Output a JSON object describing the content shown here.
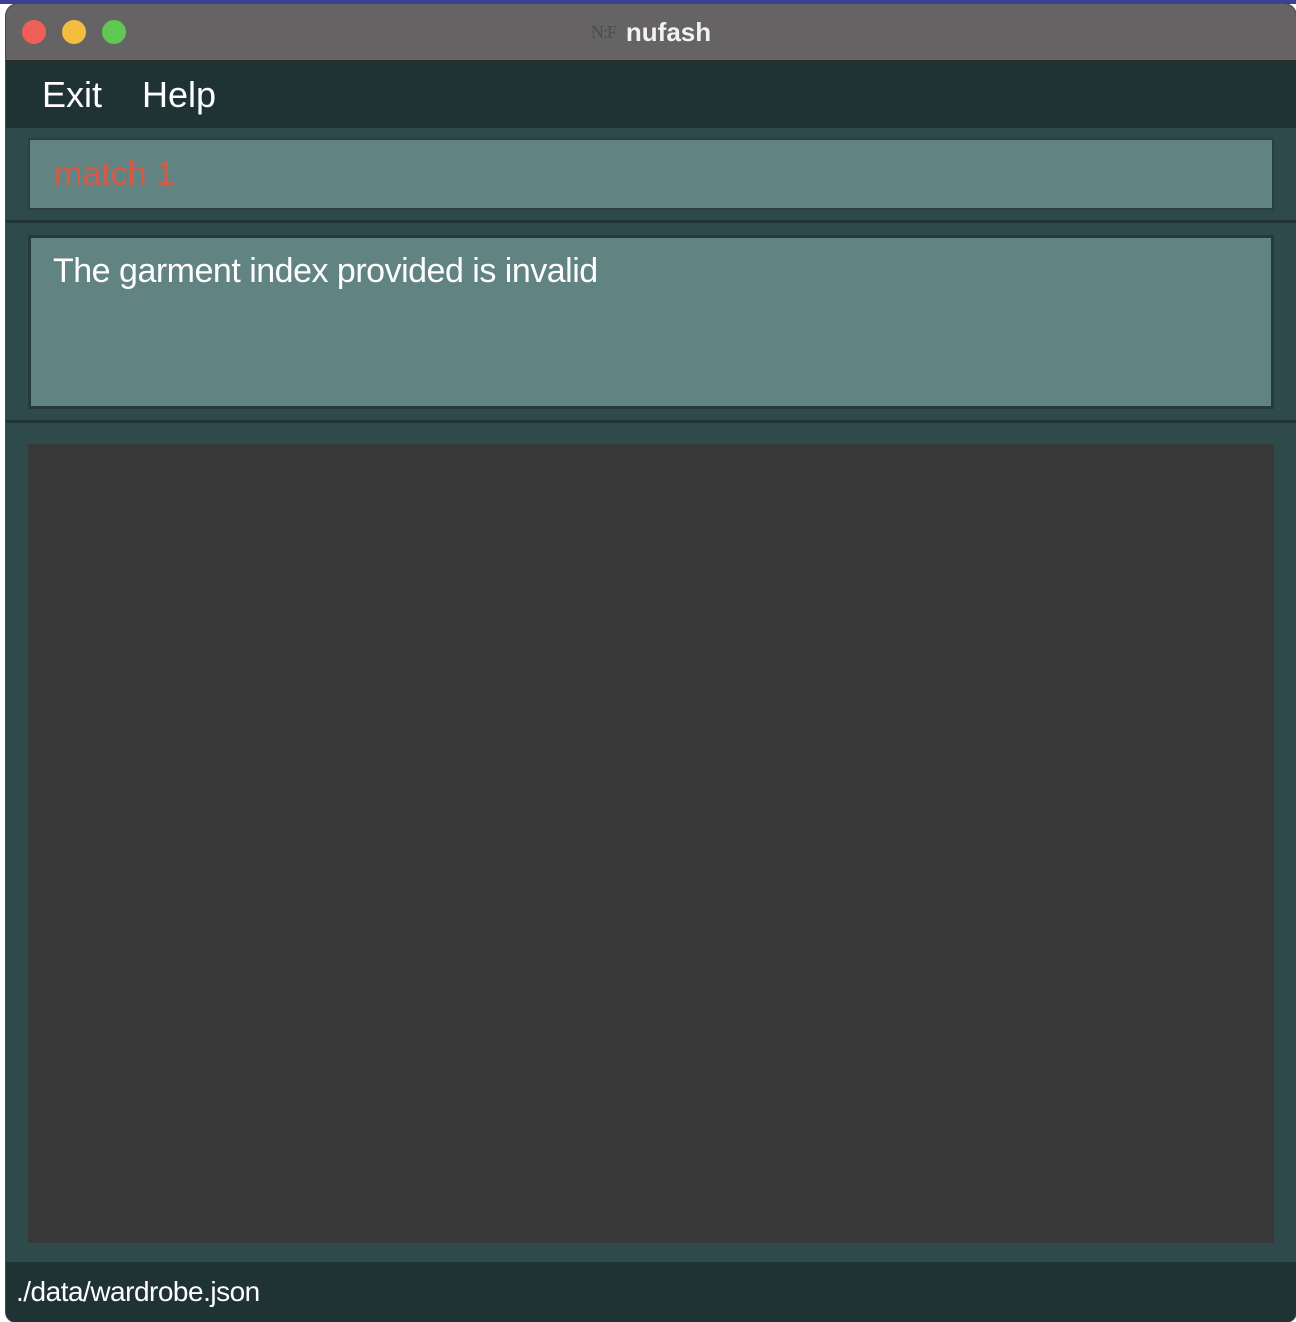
{
  "window": {
    "logo": "N:F",
    "title": "nufash"
  },
  "menu": {
    "items": [
      {
        "label": "Exit"
      },
      {
        "label": "Help"
      }
    ]
  },
  "command": {
    "value": "match 1",
    "text_color": "#d65a46"
  },
  "result": {
    "message": "The garment index provided is invalid"
  },
  "status": {
    "file_path": "./data/wardrobe.json"
  },
  "colors": {
    "titlebar": "#656364",
    "menubar": "#1f3234",
    "panel_bg": "#2f4a4a",
    "box_bg": "#618382",
    "list_bg": "#383838"
  }
}
